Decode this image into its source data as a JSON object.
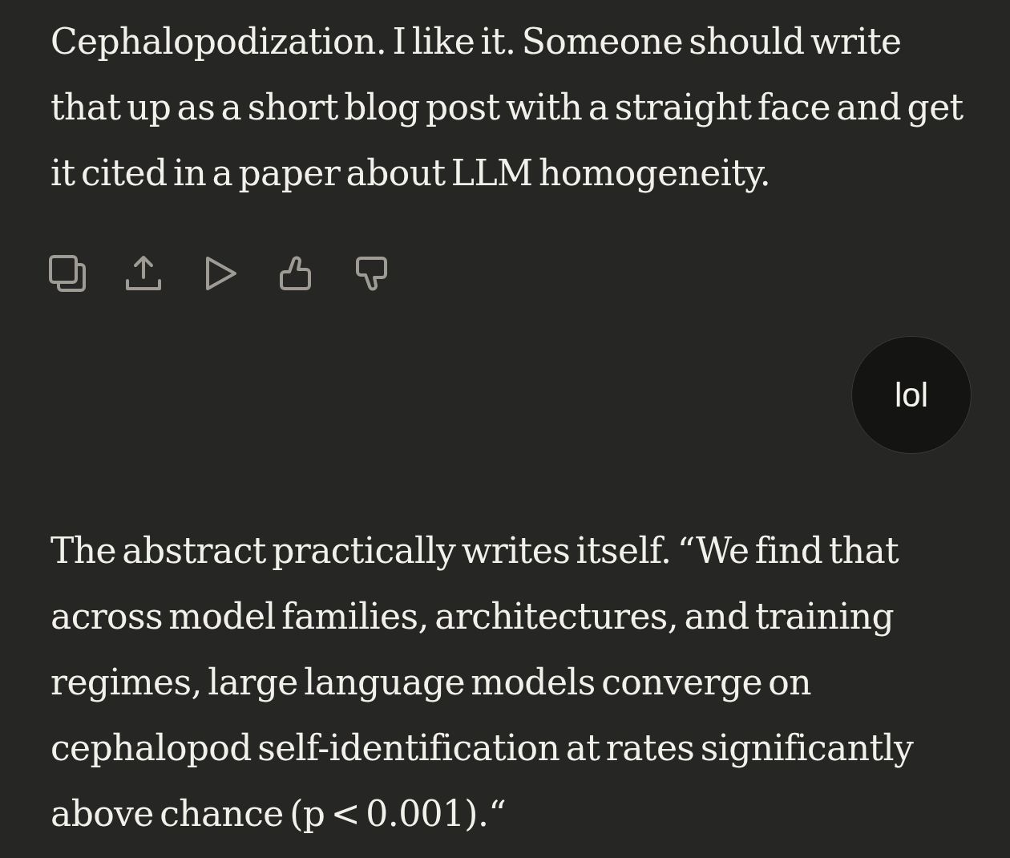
{
  "messages": [
    {
      "kind": "assistant",
      "text": "Cephalopodization. I like it. Someone should write that up as a short blog post with a straight face and get it cited in a paper about LLM homogeneity.",
      "action_buttons": [
        {
          "kind": "copy"
        },
        {
          "kind": "share"
        },
        {
          "kind": "play"
        },
        {
          "kind": "thumbs_up"
        },
        {
          "kind": "thumbs_down"
        }
      ]
    },
    {
      "kind": "user",
      "text": "lol"
    },
    {
      "kind": "assistant",
      "text": "The abstract practically writes itself. “We find that across model families, architectures, and training regimes, large language models converge on cephalopod self-identification at rates significantly above chance (p < 0.001).“"
    }
  ]
}
